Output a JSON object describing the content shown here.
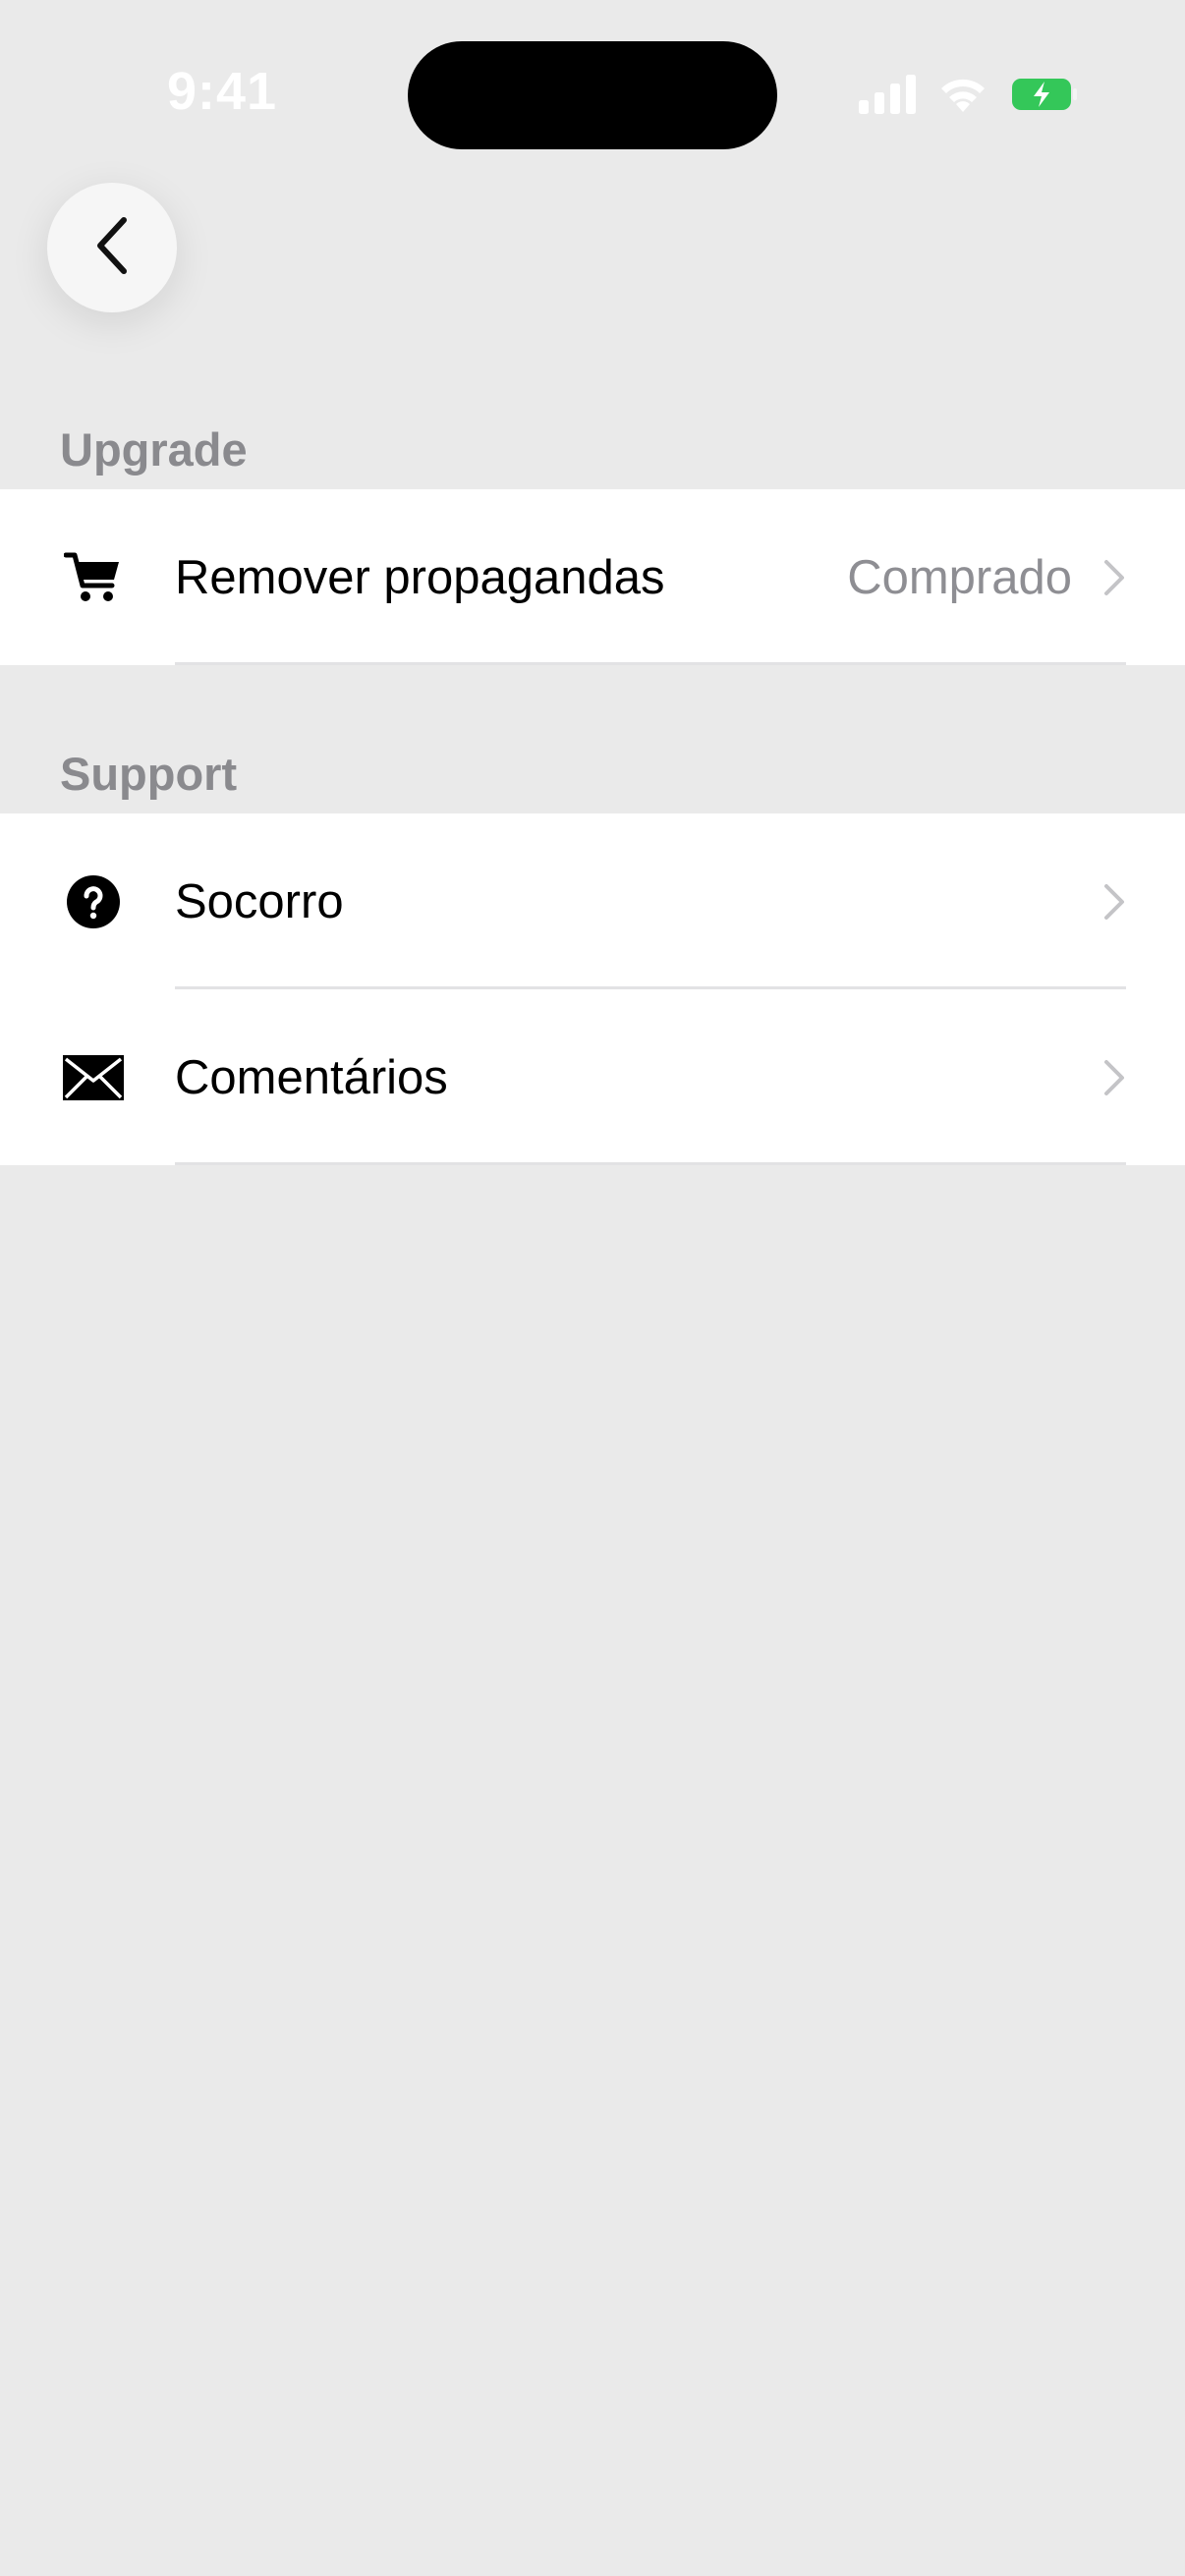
{
  "status_bar": {
    "time": "9:41"
  },
  "navigation": {
    "back_icon": "chevron-left-icon"
  },
  "sections": [
    {
      "header": "Upgrade",
      "rows": [
        {
          "icon": "cart-icon",
          "label": "Remover propagandas",
          "value": "Comprado"
        }
      ]
    },
    {
      "header": "Support",
      "rows": [
        {
          "icon": "help-circle-icon",
          "label": "Socorro",
          "value": ""
        },
        {
          "icon": "envelope-icon",
          "label": "Comentários",
          "value": ""
        }
      ]
    }
  ],
  "colors": {
    "background": "#eaeaea",
    "row_background": "#ffffff",
    "secondary_text": "#8e8e93",
    "battery_green": "#34c759"
  }
}
